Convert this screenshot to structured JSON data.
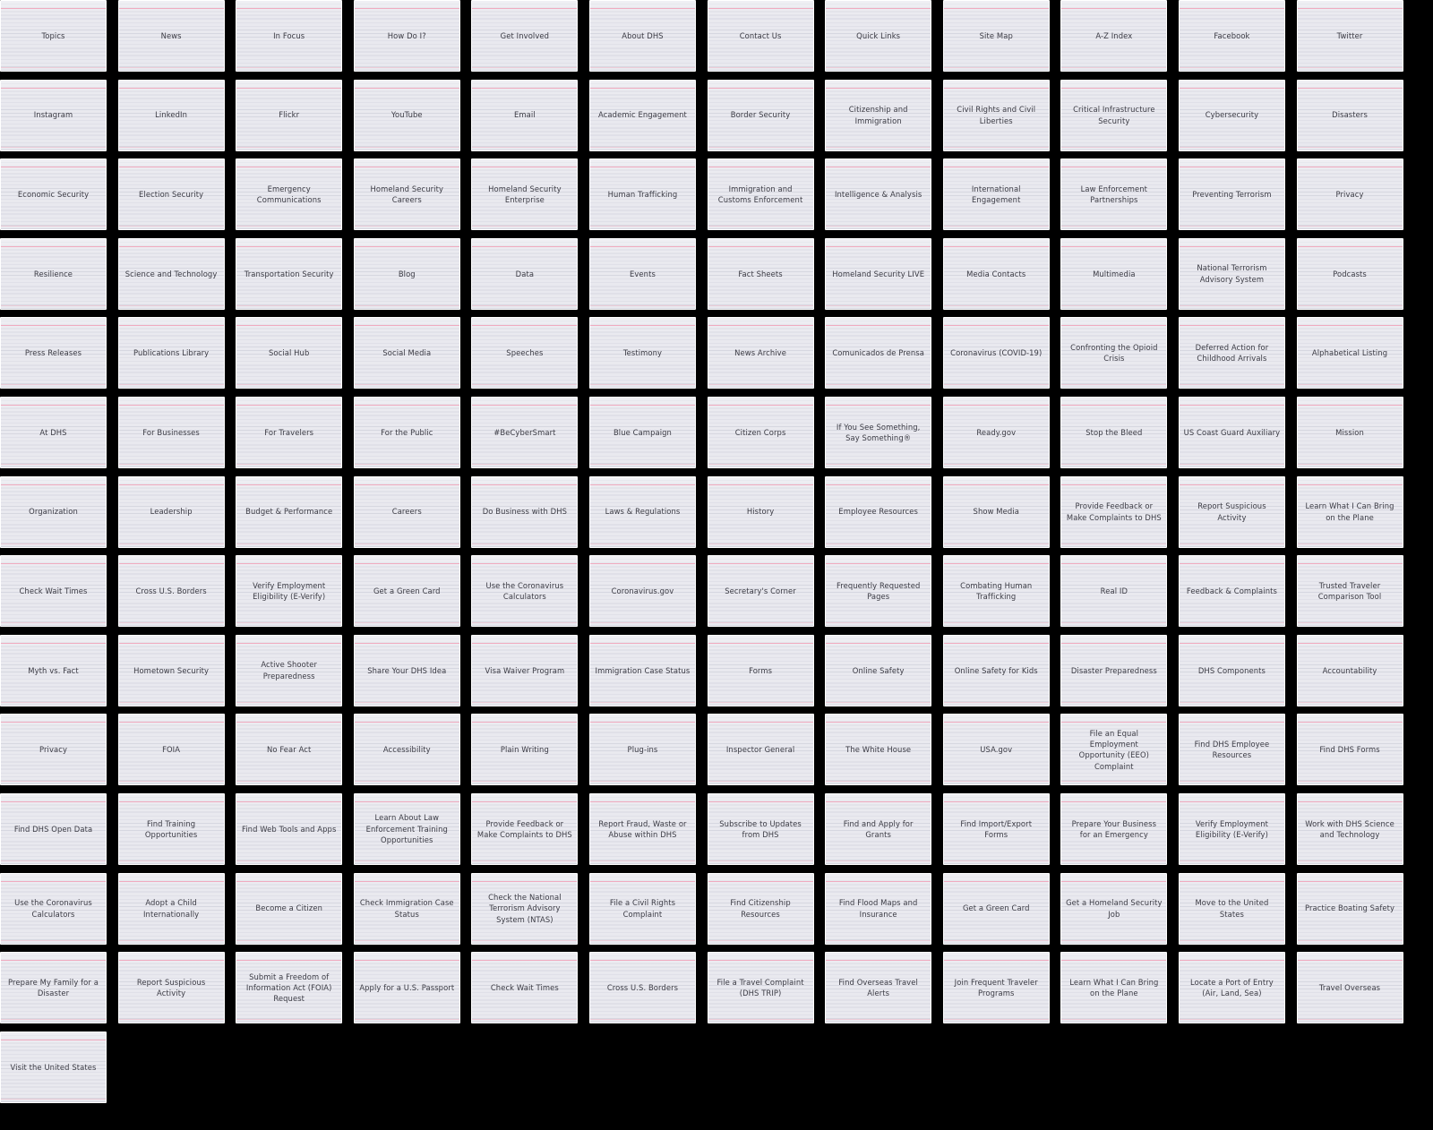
{
  "page": {
    "title": "DHS Site Links Card Grid",
    "background_color": "#000000",
    "card_background_color": "#e9e9ef",
    "card_rule_color": "#d6d7e0",
    "card_margin_line_color": "#f0a8bc",
    "card_text_color": "#3b3b44",
    "columns": 12,
    "rows": 14,
    "total_cards": 157
  },
  "cards": [
    {
      "label": "Topics"
    },
    {
      "label": "News"
    },
    {
      "label": "In Focus"
    },
    {
      "label": "How Do I?"
    },
    {
      "label": "Get Involved"
    },
    {
      "label": "About DHS"
    },
    {
      "label": "Contact Us"
    },
    {
      "label": "Quick Links"
    },
    {
      "label": "Site Map"
    },
    {
      "label": "A-Z Index"
    },
    {
      "label": "Facebook"
    },
    {
      "label": "Twitter"
    },
    {
      "label": "Instagram"
    },
    {
      "label": "LinkedIn"
    },
    {
      "label": "Flickr"
    },
    {
      "label": "YouTube"
    },
    {
      "label": "Email"
    },
    {
      "label": "Academic Engagement"
    },
    {
      "label": "Border Security"
    },
    {
      "label": "Citizenship and Immigration"
    },
    {
      "label": "Civil Rights and Civil Liberties"
    },
    {
      "label": "Critical Infrastructure Security"
    },
    {
      "label": "Cybersecurity"
    },
    {
      "label": "Disasters"
    },
    {
      "label": "Economic Security"
    },
    {
      "label": "Election Security"
    },
    {
      "label": "Emergency Communications"
    },
    {
      "label": "Homeland Security Careers"
    },
    {
      "label": "Homeland Security Enterprise"
    },
    {
      "label": "Human Trafficking"
    },
    {
      "label": "Immigration and Customs Enforcement"
    },
    {
      "label": "Intelligence & Analysis"
    },
    {
      "label": "International Engagement"
    },
    {
      "label": "Law Enforcement Partnerships"
    },
    {
      "label": "Preventing Terrorism"
    },
    {
      "label": "Privacy"
    },
    {
      "label": "Resilience"
    },
    {
      "label": "Science and Technology"
    },
    {
      "label": "Transportation Security"
    },
    {
      "label": "Blog"
    },
    {
      "label": "Data"
    },
    {
      "label": "Events"
    },
    {
      "label": "Fact Sheets"
    },
    {
      "label": "Homeland Security LIVE"
    },
    {
      "label": "Media Contacts"
    },
    {
      "label": "Multimedia"
    },
    {
      "label": "National Terrorism Advisory System"
    },
    {
      "label": "Podcasts"
    },
    {
      "label": "Press Releases"
    },
    {
      "label": "Publications Library"
    },
    {
      "label": "Social Hub"
    },
    {
      "label": "Social Media"
    },
    {
      "label": "Speeches"
    },
    {
      "label": "Testimony"
    },
    {
      "label": "News Archive"
    },
    {
      "label": "Comunicados de Prensa"
    },
    {
      "label": "Coronavirus (COVID-19)"
    },
    {
      "label": "Confronting the Opioid Crisis"
    },
    {
      "label": "Deferred Action for Childhood Arrivals"
    },
    {
      "label": "Alphabetical Listing"
    },
    {
      "label": "At DHS"
    },
    {
      "label": "For Businesses"
    },
    {
      "label": "For Travelers"
    },
    {
      "label": "For the Public"
    },
    {
      "label": "#BeCyberSmart"
    },
    {
      "label": "Blue Campaign"
    },
    {
      "label": "Citizen Corps"
    },
    {
      "label": "If You See Something, Say Something®"
    },
    {
      "label": "Ready.gov"
    },
    {
      "label": "Stop the Bleed"
    },
    {
      "label": "US Coast Guard Auxiliary"
    },
    {
      "label": "Mission"
    },
    {
      "label": "Organization"
    },
    {
      "label": "Leadership"
    },
    {
      "label": "Budget & Performance"
    },
    {
      "label": "Careers"
    },
    {
      "label": "Do Business with DHS"
    },
    {
      "label": "Laws & Regulations"
    },
    {
      "label": "History"
    },
    {
      "label": "Employee Resources"
    },
    {
      "label": "Show Media"
    },
    {
      "label": "Provide Feedback or Make Complaints to DHS"
    },
    {
      "label": "Report Suspicious Activity"
    },
    {
      "label": "Learn What I Can Bring on the Plane"
    },
    {
      "label": "Check Wait Times"
    },
    {
      "label": "Cross U.S. Borders"
    },
    {
      "label": "Verify Employment Eligibility (E-Verify)"
    },
    {
      "label": "Get a Green Card"
    },
    {
      "label": "Use the Coronavirus Calculators"
    },
    {
      "label": "Coronavirus.gov"
    },
    {
      "label": "Secretary's Corner"
    },
    {
      "label": "Frequently Requested Pages"
    },
    {
      "label": "Combating Human Trafficking"
    },
    {
      "label": "Real ID"
    },
    {
      "label": "Feedback & Complaints"
    },
    {
      "label": "Trusted Traveler Comparison Tool"
    },
    {
      "label": "Myth vs. Fact"
    },
    {
      "label": "Hometown Security"
    },
    {
      "label": "Active Shooter Preparedness"
    },
    {
      "label": "Share Your DHS Idea"
    },
    {
      "label": "Visa Waiver Program"
    },
    {
      "label": "Immigration Case Status"
    },
    {
      "label": "Forms"
    },
    {
      "label": "Online Safety"
    },
    {
      "label": "Online Safety for Kids"
    },
    {
      "label": "Disaster Preparedness"
    },
    {
      "label": "DHS Components"
    },
    {
      "label": "Accountability"
    },
    {
      "label": "Privacy"
    },
    {
      "label": "FOIA"
    },
    {
      "label": "No Fear Act"
    },
    {
      "label": "Accessibility"
    },
    {
      "label": "Plain Writing"
    },
    {
      "label": "Plug-ins"
    },
    {
      "label": "Inspector General"
    },
    {
      "label": "The White House"
    },
    {
      "label": "USA.gov"
    },
    {
      "label": "File an Equal Employment Opportunity (EEO) Complaint"
    },
    {
      "label": "Find DHS Employee Resources"
    },
    {
      "label": "Find DHS Forms"
    },
    {
      "label": "Find DHS Open Data"
    },
    {
      "label": "Find Training Opportunities"
    },
    {
      "label": "Find Web Tools and Apps"
    },
    {
      "label": "Learn About Law Enforcement Training Opportunities"
    },
    {
      "label": "Provide Feedback or Make Complaints to DHS"
    },
    {
      "label": "Report Fraud, Waste or Abuse within DHS"
    },
    {
      "label": "Subscribe to Updates from DHS"
    },
    {
      "label": "Find and Apply for Grants"
    },
    {
      "label": "Find Import/Export Forms"
    },
    {
      "label": "Prepare Your Business for an Emergency"
    },
    {
      "label": "Verify Employment Eligibility (E-Verify)"
    },
    {
      "label": "Work with DHS Science and Technology"
    },
    {
      "label": "Use the Coronavirus Calculators"
    },
    {
      "label": "Adopt a Child Internationally"
    },
    {
      "label": "Become a Citizen"
    },
    {
      "label": "Check Immigration Case Status"
    },
    {
      "label": "Check the National Terrorism Advisory System (NTAS)"
    },
    {
      "label": "File a Civil Rights Complaint"
    },
    {
      "label": "Find Citizenship Resources"
    },
    {
      "label": "Find Flood Maps and Insurance"
    },
    {
      "label": "Get a Green Card"
    },
    {
      "label": "Get a Homeland Security Job"
    },
    {
      "label": "Move to the United States"
    },
    {
      "label": "Practice Boating Safety"
    },
    {
      "label": "Prepare My Family for a Disaster"
    },
    {
      "label": "Report Suspicious Activity"
    },
    {
      "label": "Submit a Freedom of Information Act (FOIA) Request"
    },
    {
      "label": "Apply for a U.S. Passport"
    },
    {
      "label": "Check Wait Times"
    },
    {
      "label": "Cross U.S. Borders"
    },
    {
      "label": "File a Travel Complaint (DHS TRIP)"
    },
    {
      "label": "Find Overseas Travel Alerts"
    },
    {
      "label": "Join Frequent Traveler Programs"
    },
    {
      "label": "Learn What I Can Bring on the Plane"
    },
    {
      "label": "Locate a Port of Entry (Air, Land, Sea)"
    },
    {
      "label": "Travel Overseas"
    },
    {
      "label": "Visit the United States"
    }
  ]
}
